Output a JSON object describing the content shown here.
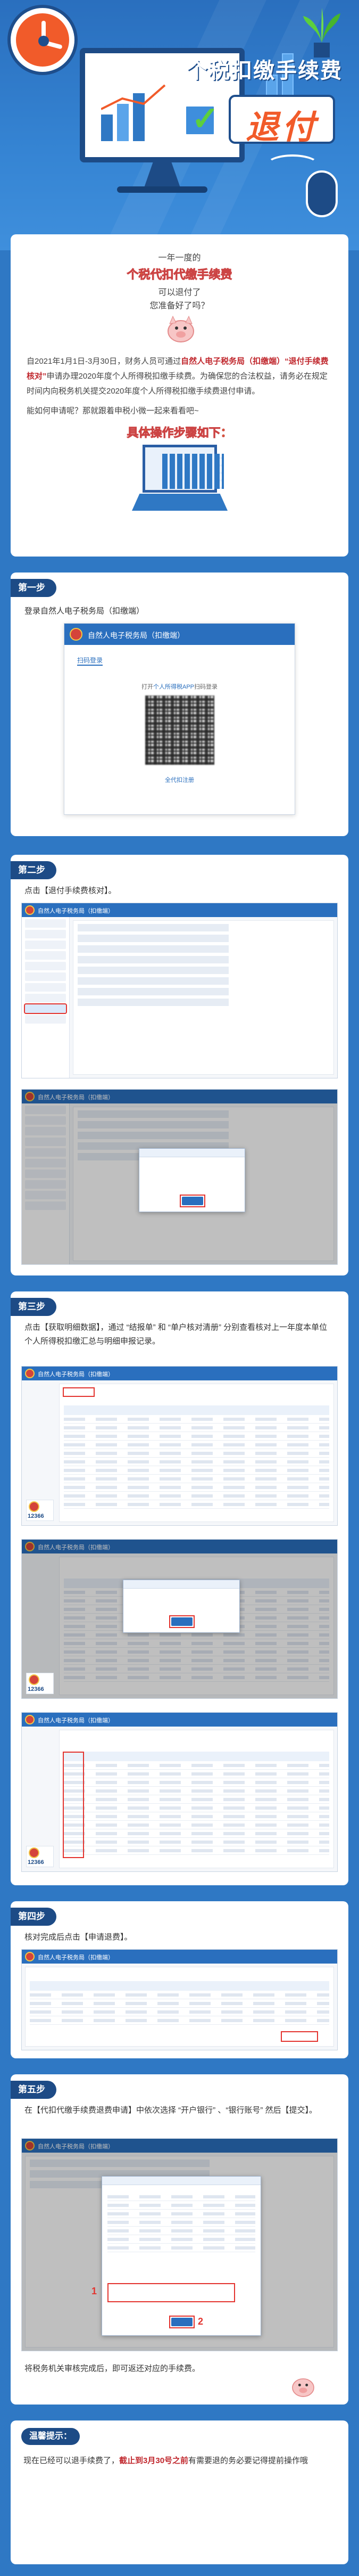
{
  "hero": {
    "title": "个税扣缴手续费",
    "badge": "退付"
  },
  "intro": {
    "pre": "一年一度的",
    "headline": "个税代扣代缴手续费",
    "q1": "可以退付了",
    "q2": "您准备好了吗？",
    "para_a": "自2021年1月1日-3月30日，财务人员可通过",
    "para_hl1": "自然人电子税务局（扣缴端）",
    "para_b": "",
    "para_hl2": "“退付手续费核对”",
    "para_c": "申请办理2020年度个人所得税扣缴手续费。为确保您的合法权益，请务必在规定时间内向税务机关提交2020年度个人所得税扣缴手续费退付申请。",
    "para2": "能如何申请呢？那就跟着申税小微一起来看看吧~",
    "follow": "具体操作步骤如下："
  },
  "step1": {
    "tag": "第一步",
    "text": "登录自然人电子税务局（扣缴端）",
    "login": {
      "app_title": "自然人电子税务局（扣缴端）",
      "tab": "扫码登录",
      "hint_a": "打开",
      "hint_link": "个人所得税APP",
      "hint_b": "扫码登录",
      "register": "全代扣注册"
    }
  },
  "step2": {
    "tag": "第二步",
    "text": "点击【退付手续费核对】。",
    "app_title": "自然人电子税务局（扣缴端）"
  },
  "step3": {
    "tag": "第三步",
    "text": "点击【获取明细数据】，通过 “结报单” 和 “单户核对清册” 分别查看核对上一年度本单位个人所得税扣缴汇总与明细申报记录。",
    "app_title": "自然人电子税务局（扣缴端）",
    "hotline": "12366"
  },
  "step4": {
    "tag": "第四步",
    "text": "核对完成后点击【申请退费】。"
  },
  "step5": {
    "tag": "第五步",
    "text": "在【代扣代缴手续费退费申请】中依次选择 “开户银行” 、“银行账号” 然后【提交】。",
    "after": "将税务机关审核完成后，即可返还对应的手续费。",
    "num1": "1",
    "num2": "2"
  },
  "tip": {
    "label": "温馨提示：",
    "text_a": "现在已经可以退手续费了，",
    "text_hl": "截止到3月30号之前",
    "text_b": "有需要退的务必要记得提前操作哦"
  },
  "colors": {
    "background": "#2f78c4",
    "accent": "#1d4b86",
    "highlight": "#c0272d",
    "title_orange": "#f7a600",
    "red_box": "#e3342f"
  }
}
